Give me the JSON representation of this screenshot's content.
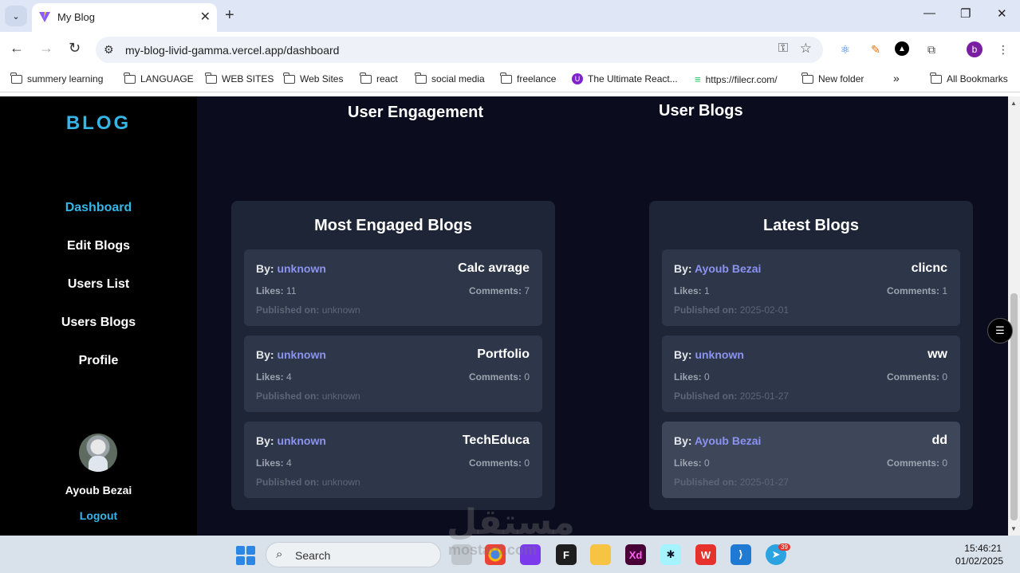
{
  "browser": {
    "tab_title": "My Blog",
    "url": "my-blog-livid-gamma.vercel.app/dashboard",
    "bookmarks": [
      {
        "label": "summery learning",
        "icon": "folder-icon"
      },
      {
        "label": "LANGUAGE",
        "icon": "folder-icon"
      },
      {
        "label": "WEB SITES",
        "icon": "folder-icon"
      },
      {
        "label": "Web Sites",
        "icon": "folder-icon"
      },
      {
        "label": "react",
        "icon": "folder-icon"
      },
      {
        "label": "social media",
        "icon": "folder-icon"
      },
      {
        "label": "freelance",
        "icon": "folder-icon"
      },
      {
        "label": "The Ultimate React...",
        "icon": "site-icon"
      },
      {
        "label": "https://filecr.com/",
        "icon": "site-icon"
      },
      {
        "label": "New folder",
        "icon": "folder-icon"
      }
    ],
    "more_bookmarks": "»",
    "all_bookmarks": "All Bookmarks",
    "profile_initial": "b"
  },
  "sidebar": {
    "brand": "BLOG",
    "nav": [
      "Dashboard",
      "Edit Blogs",
      "Users List",
      "Users Blogs",
      "Profile"
    ],
    "active": "Dashboard",
    "user_name": "Ayoub Bezai",
    "logout": "Logout"
  },
  "main": {
    "engagement_title": "User Engagement",
    "user_blogs_title": "User Blogs",
    "labels": {
      "by": "By:",
      "likes": "Likes:",
      "comments": "Comments:",
      "published": "Published on:"
    },
    "most_engaged": {
      "title": "Most Engaged Blogs",
      "blogs": [
        {
          "author": "unknown",
          "title": "Calc avrage",
          "likes": "11",
          "comments": "7",
          "published": "unknown"
        },
        {
          "author": "unknown",
          "title": "Portfolio",
          "likes": "4",
          "comments": "0",
          "published": "unknown"
        },
        {
          "author": "unknown",
          "title": "TechEduca",
          "likes": "4",
          "comments": "0",
          "published": "unknown"
        }
      ]
    },
    "latest": {
      "title": "Latest Blogs",
      "blogs": [
        {
          "author": "Ayoub Bezai",
          "title": "clicnc",
          "likes": "1",
          "comments": "1",
          "published": "2025-02-01"
        },
        {
          "author": "unknown",
          "title": "ww",
          "likes": "0",
          "comments": "0",
          "published": "2025-01-27"
        },
        {
          "author": "Ayoub Bezai",
          "title": "dd",
          "likes": "0",
          "comments": "0",
          "published": "2025-01-27"
        }
      ]
    }
  },
  "taskbar": {
    "search_label": "Search",
    "time": "15:46:21",
    "date": "01/02/2025",
    "telegram_badge": "39"
  },
  "watermark": {
    "text": "مستقل",
    "sub": "mostaql.com"
  },
  "colors": {
    "accent": "#35b6e8",
    "author": "#8b93f0",
    "page_bg": "#0b0d1f",
    "panel_bg": "#1e2536",
    "card_bg": "#2e3749"
  }
}
